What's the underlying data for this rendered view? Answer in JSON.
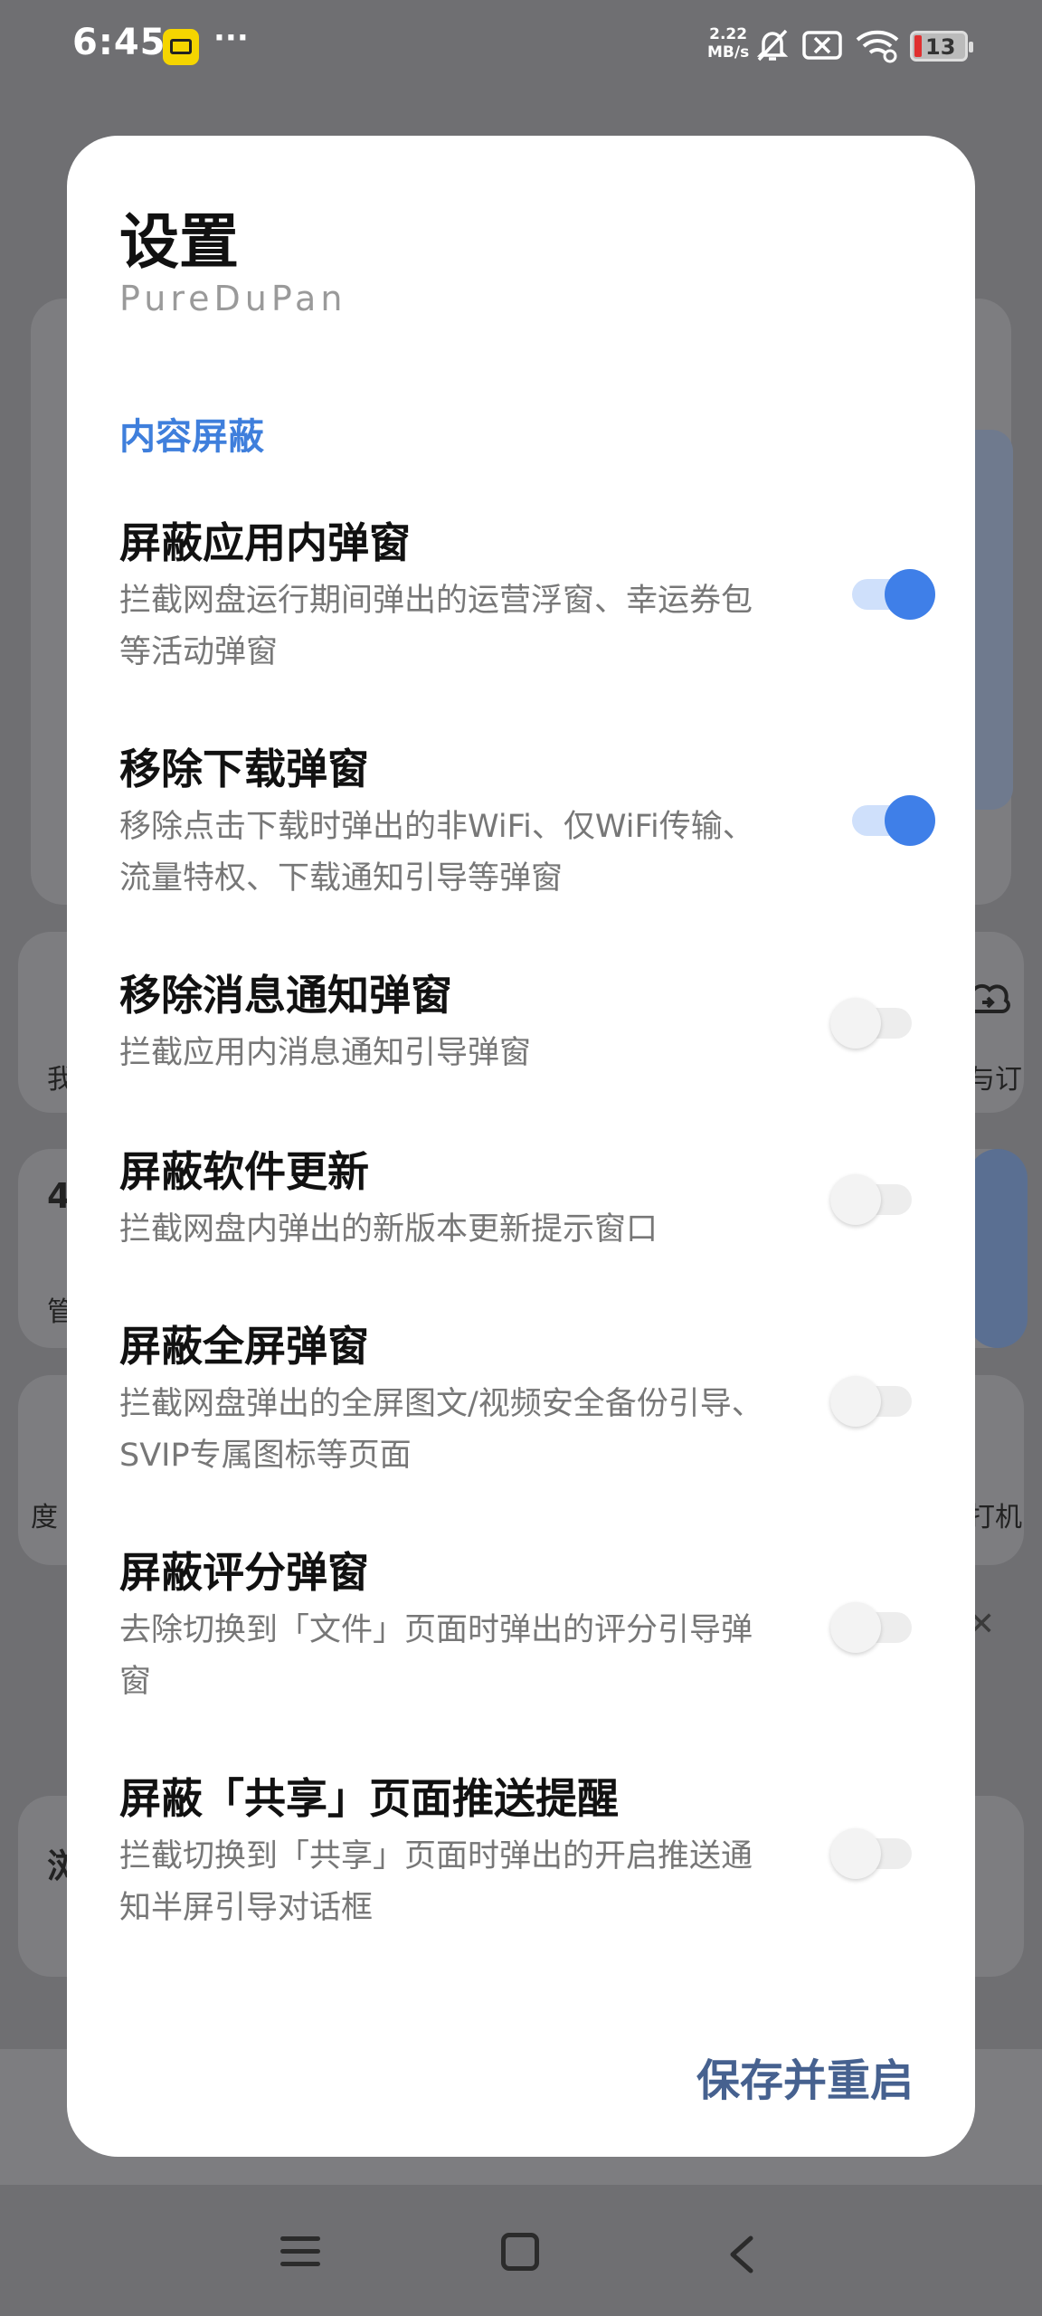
{
  "status_bar": {
    "time": "6:45",
    "more": "···",
    "net_speed_value": "2.22",
    "net_speed_unit": "MB/s",
    "battery": "13",
    "icons": [
      "app-notification-icon",
      "mute-icon",
      "no-sim-icon",
      "wifi-icon",
      "battery-icon"
    ]
  },
  "background": {
    "left_texts": [
      "我",
      "4",
      "管",
      "度"
    ],
    "right_texts": [
      "与订",
      "打机"
    ],
    "bottom_left": "浏"
  },
  "dialog": {
    "title": "设置",
    "subtitle": "PureDuPan",
    "section": "内容屏蔽",
    "settings": [
      {
        "title": "屏蔽应用内弹窗",
        "desc": "拦截网盘运行期间弹出的运营浮窗、幸运券包等活动弹窗",
        "enabled": true
      },
      {
        "title": "移除下载弹窗",
        "desc": "移除点击下载时弹出的非WiFi、仅WiFi传输、流量特权、下载通知引导等弹窗",
        "enabled": true
      },
      {
        "title": "移除消息通知弹窗",
        "desc": "拦截应用内消息通知引导弹窗",
        "enabled": false
      },
      {
        "title": "屏蔽软件更新",
        "desc": "拦截网盘内弹出的新版本更新提示窗口",
        "enabled": false
      },
      {
        "title": "屏蔽全屏弹窗",
        "desc": "拦截网盘弹出的全屏图文/视频安全备份引导、SVIP专属图标等页面",
        "enabled": false
      },
      {
        "title": "屏蔽评分弹窗",
        "desc": "去除切换到「文件」页面时弹出的评分引导弹窗",
        "enabled": false
      },
      {
        "title": "屏蔽「共享」页面推送提醒",
        "desc": "拦截切换到「共享」页面时弹出的开启推送通知半屏引导对话框",
        "enabled": false
      }
    ],
    "save_button": "保存并重启"
  },
  "nav_bar": {
    "icons": [
      "menu-icon",
      "home-icon",
      "back-icon"
    ]
  },
  "colors": {
    "accent": "#3f7fe8",
    "section_label": "#3f7fdc",
    "save_button": "#46618f",
    "scrim": "#6f6f72"
  }
}
